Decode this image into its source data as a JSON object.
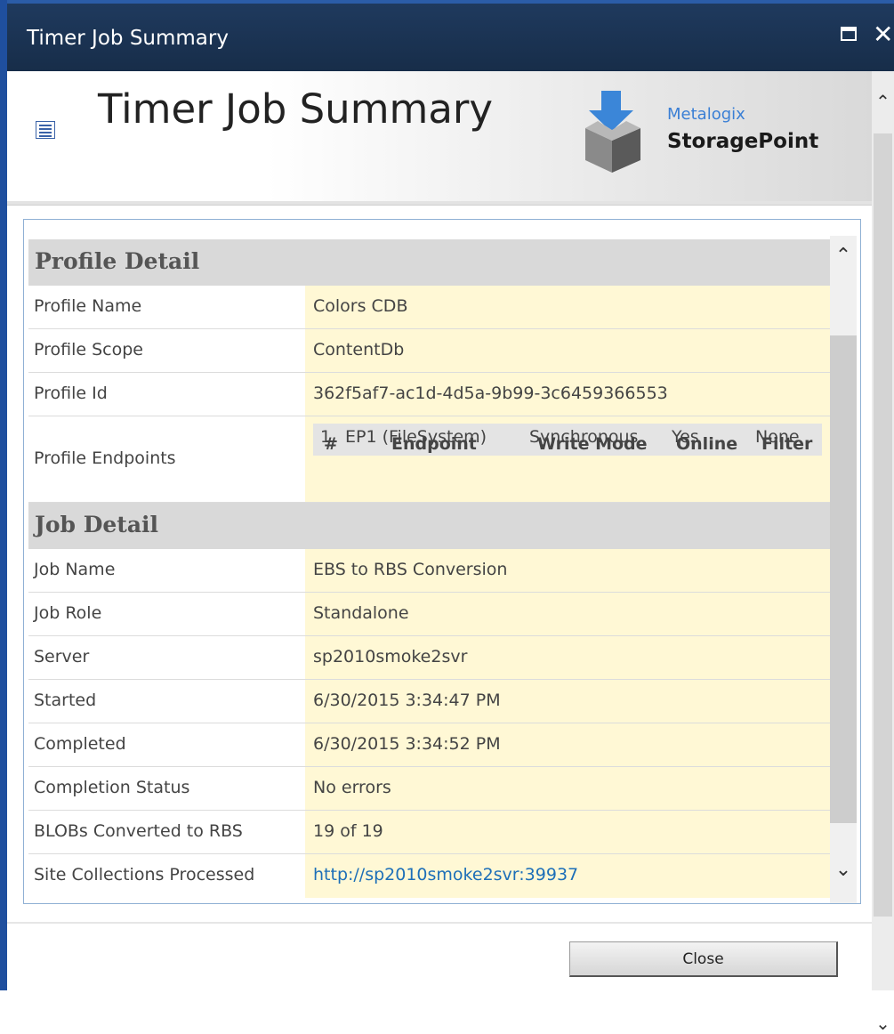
{
  "window": {
    "title": "Timer Job Summary",
    "maximize_icon": "maximize-icon",
    "close_icon": "close-icon",
    "close_glyph": "✕"
  },
  "header": {
    "page_title": "Timer Job Summary",
    "logo_brand": "Metalogix",
    "logo_product": "StoragePoint"
  },
  "profile_detail": {
    "heading": "Profile Detail",
    "rows": [
      {
        "label": "Profile Name",
        "value": "Colors CDB"
      },
      {
        "label": "Profile Scope",
        "value": "ContentDb"
      },
      {
        "label": "Profile Id",
        "value": "362f5af7-ac1d-4d5a-9b99-3c6459366553"
      }
    ],
    "endpoints_label": "Profile Endpoints",
    "endpoints_headers": [
      "#",
      "Endpoint",
      "Write Mode",
      "Online",
      "Filter"
    ],
    "endpoints_rows": [
      [
        "1",
        "EP1 (FileSystem)",
        "Synchronous",
        "Yes",
        "None"
      ]
    ]
  },
  "job_detail": {
    "heading": "Job Detail",
    "rows": [
      {
        "label": "Job Name",
        "value": "EBS to RBS Conversion"
      },
      {
        "label": "Job Role",
        "value": "Standalone"
      },
      {
        "label": "Server",
        "value": "sp2010smoke2svr"
      },
      {
        "label": "Started",
        "value": "6/30/2015 3:34:47 PM"
      },
      {
        "label": "Completed",
        "value": "6/30/2015 3:34:52 PM"
      },
      {
        "label": "Completion Status",
        "value": "No errors"
      },
      {
        "label": "BLOBs Converted to RBS",
        "value": "19 of 19"
      }
    ],
    "site_collections_label": "Site Collections Processed",
    "site_collections_link": "http://sp2010smoke2svr:39937"
  },
  "footer": {
    "close_label": "Close"
  },
  "colors": {
    "titlebar": "#1f3a5e",
    "value_background": "#fff8d5",
    "section_background": "#d9d9d9",
    "link": "#1d6fb8"
  }
}
